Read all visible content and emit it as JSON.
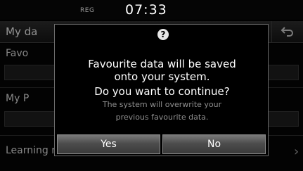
{
  "status": {
    "label": "REG",
    "time": "07:33"
  },
  "header": {
    "title": "My da",
    "back_icon": "back-arrow-icon"
  },
  "list": {
    "items": [
      {
        "label": "Favo"
      },
      {
        "label": "My P"
      },
      {
        "label": "Learning route"
      }
    ]
  },
  "dialog": {
    "icon": "question-icon",
    "message_lines": [
      "Favourite data will be saved",
      "onto your system.",
      "Do you want to continue?"
    ],
    "note_lines": [
      "The system will overwrite your",
      "previous favourite data."
    ],
    "yes_label": "Yes",
    "no_label": "No"
  }
}
